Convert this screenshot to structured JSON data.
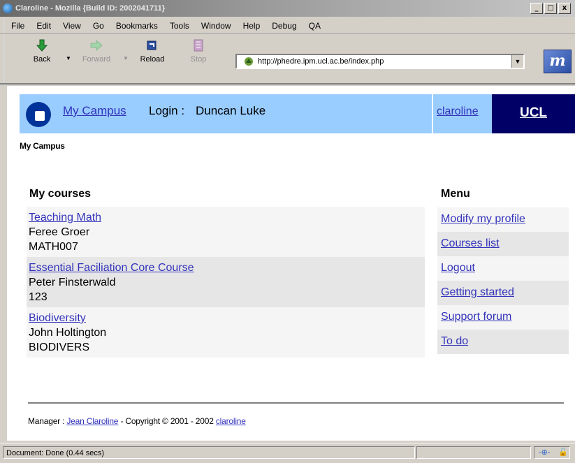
{
  "window": {
    "title": "Claroline - Mozilla {Build ID: 2002041711}",
    "controls": [
      "_",
      "□",
      "x"
    ]
  },
  "menubar": {
    "items": [
      "File",
      "Edit",
      "View",
      "Go",
      "Bookmarks",
      "Tools",
      "Window",
      "Help",
      "Debug",
      "QA"
    ]
  },
  "navbar": {
    "back": "Back",
    "forward": "Forward",
    "reload": "Reload",
    "stop": "Stop",
    "url": "http://phedre.ipm.ucl.ac.be/index.php"
  },
  "banner": {
    "home_link": "My Campus",
    "login_label": "Login :",
    "login_name": "Duncan Luke",
    "claroline_link": "claroline",
    "institution": "UCL"
  },
  "breadcrumb": "My Campus",
  "courses": {
    "heading": "My courses",
    "items": [
      {
        "title": "Teaching Math ",
        "teacher": "Feree Groer",
        "code": "MATH007"
      },
      {
        "title": "Essential Faciliation Core Course ",
        "teacher": "Peter Finsterwald",
        "code": "123"
      },
      {
        "title": "Biodiversity ",
        "teacher": "John Holtington",
        "code": "BIODIVERS"
      }
    ]
  },
  "menu": {
    "heading": "Menu",
    "items": [
      "Modify my profile",
      "Courses list",
      "Logout",
      "Getting started",
      "Support forum",
      "To do"
    ]
  },
  "footer": {
    "manager_label": "Manager :",
    "manager_name": "Jean Claroline",
    "copyright": "- Copyright © 2001 - 2002",
    "claroline_link": "claroline"
  },
  "statusbar": {
    "text": "Document: Done (0.44 secs)"
  },
  "colors": {
    "banner_bg": "#99ccff",
    "ucl_bg": "#000066",
    "link": "#3333bb",
    "campus_icon": "#003399"
  }
}
